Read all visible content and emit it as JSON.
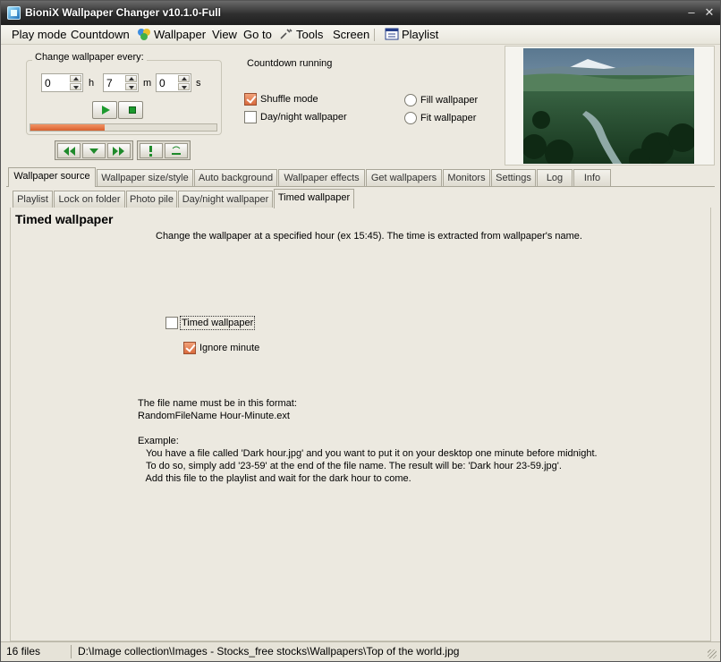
{
  "window": {
    "title": "BioniX Wallpaper Changer v10.1.0-Full"
  },
  "menu": {
    "play_mode": "Play mode",
    "countdown": "Countdown",
    "wallpaper": "Wallpaper",
    "view": "View",
    "go_to": "Go to",
    "tools": "Tools",
    "screen": "Screen",
    "playlist": "Playlist"
  },
  "timer": {
    "group_title": "Change wallpaper every:",
    "hours": "0",
    "minutes": "7",
    "seconds": "0",
    "h_label": "h",
    "m_label": "m",
    "s_label": "s",
    "progress": 0.4
  },
  "status": {
    "countdown": "Countdown running"
  },
  "options": {
    "shuffle_mode": "Shuffle mode",
    "shuffle_checked": true,
    "day_night": "Day/night wallpaper",
    "day_night_checked": false,
    "fill": "Fill wallpaper",
    "fit": "Fit wallpaper"
  },
  "main_tabs": [
    {
      "label": "Wallpaper source",
      "active": true
    },
    {
      "label": "Wallpaper size/style"
    },
    {
      "label": "Auto background"
    },
    {
      "label": "Wallpaper effects"
    },
    {
      "label": "Get wallpapers"
    },
    {
      "label": "Monitors"
    },
    {
      "label": "Settings"
    },
    {
      "label": "Log"
    },
    {
      "label": "Info"
    }
  ],
  "sub_tabs": [
    {
      "label": "Playlist"
    },
    {
      "label": "Lock on folder"
    },
    {
      "label": "Photo pile"
    },
    {
      "label": "Day/night wallpaper"
    },
    {
      "label": "Timed wallpaper",
      "active": true
    }
  ],
  "timed": {
    "title": "Timed wallpaper",
    "description": "Change the wallpaper at a specified hour (ex 15:45). The time is extracted from wallpaper's name.",
    "timed_checkbox": "Timed wallpaper",
    "timed_checked": false,
    "ignore_minute": "Ignore minute",
    "ignore_checked": true,
    "format_line1": "The file name must be in this format:",
    "format_line2": "RandomFileName Hour-Minute.ext",
    "example_label": "Example:",
    "example_line1": "   You have a file called 'Dark hour.jpg' and you want to put it on your desktop one minute before midnight.",
    "example_line2": "   To do so, simply add '23-59' at the end of the file name. The result will be: 'Dark hour 23-59.jpg'.",
    "example_line3": "   Add this file to the playlist and wait for the dark hour to come."
  },
  "statusbar": {
    "files": "16 files",
    "path": "D:\\Image collection\\Images - Stocks_free stocks\\Wallpapers\\Top of the world.jpg"
  },
  "colors": {
    "accent": "#d9602e",
    "title_bar": "#2f2f2f",
    "surface": "#ece9e0"
  }
}
